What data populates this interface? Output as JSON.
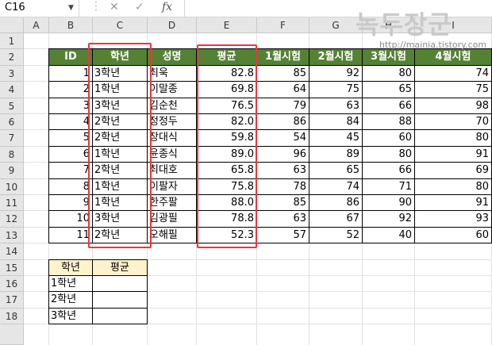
{
  "formula_bar": {
    "name_box": "C16",
    "fx_label": "fx",
    "formula": ""
  },
  "watermark": {
    "text": "녹두장군",
    "url": "http://mainia.tistory.com"
  },
  "columns": [
    "A",
    "B",
    "C",
    "D",
    "E",
    "F",
    "G",
    "H",
    "I"
  ],
  "rows": [
    "1",
    "2",
    "3",
    "4",
    "5",
    "6",
    "7",
    "8",
    "9",
    "10",
    "11",
    "12",
    "13",
    "14",
    "15",
    "16",
    "17",
    "18"
  ],
  "table": {
    "headers": [
      "ID",
      "학년",
      "성명",
      "평균",
      "1월시험",
      "2월시험",
      "3월시험",
      "4월시험"
    ],
    "rows": [
      [
        "1",
        "3학년",
        "최욱",
        "82.8",
        "85",
        "92",
        "80",
        "74"
      ],
      [
        "2",
        "1학년",
        "이말종",
        "69.8",
        "64",
        "75",
        "65",
        "75"
      ],
      [
        "3",
        "3학년",
        "김순천",
        "76.5",
        "79",
        "63",
        "66",
        "98"
      ],
      [
        "4",
        "2학년",
        "정정두",
        "82.0",
        "86",
        "84",
        "88",
        "70"
      ],
      [
        "5",
        "2학년",
        "장대식",
        "59.8",
        "54",
        "45",
        "60",
        "80"
      ],
      [
        "6",
        "1학년",
        "윤종식",
        "89.0",
        "96",
        "89",
        "80",
        "91"
      ],
      [
        "7",
        "2학년",
        "최대호",
        "65.8",
        "63",
        "65",
        "66",
        "69"
      ],
      [
        "8",
        "1학년",
        "이팔자",
        "75.8",
        "78",
        "74",
        "71",
        "80"
      ],
      [
        "9",
        "1학년",
        "한주팔",
        "88.0",
        "85",
        "86",
        "90",
        "91"
      ],
      [
        "10",
        "3학년",
        "김광필",
        "78.8",
        "63",
        "67",
        "92",
        "93"
      ],
      [
        "11",
        "2학년",
        "오해필",
        "52.3",
        "57",
        "52",
        "40",
        "60"
      ]
    ]
  },
  "summary": {
    "headers": [
      "학년",
      "평균"
    ],
    "rows": [
      [
        "1학년",
        ""
      ],
      [
        "2학년",
        ""
      ],
      [
        "3학년",
        ""
      ]
    ]
  },
  "colors": {
    "header_green": "#548235",
    "header_yellow": "#fff2cc",
    "highlight_red": "#e8383d"
  }
}
